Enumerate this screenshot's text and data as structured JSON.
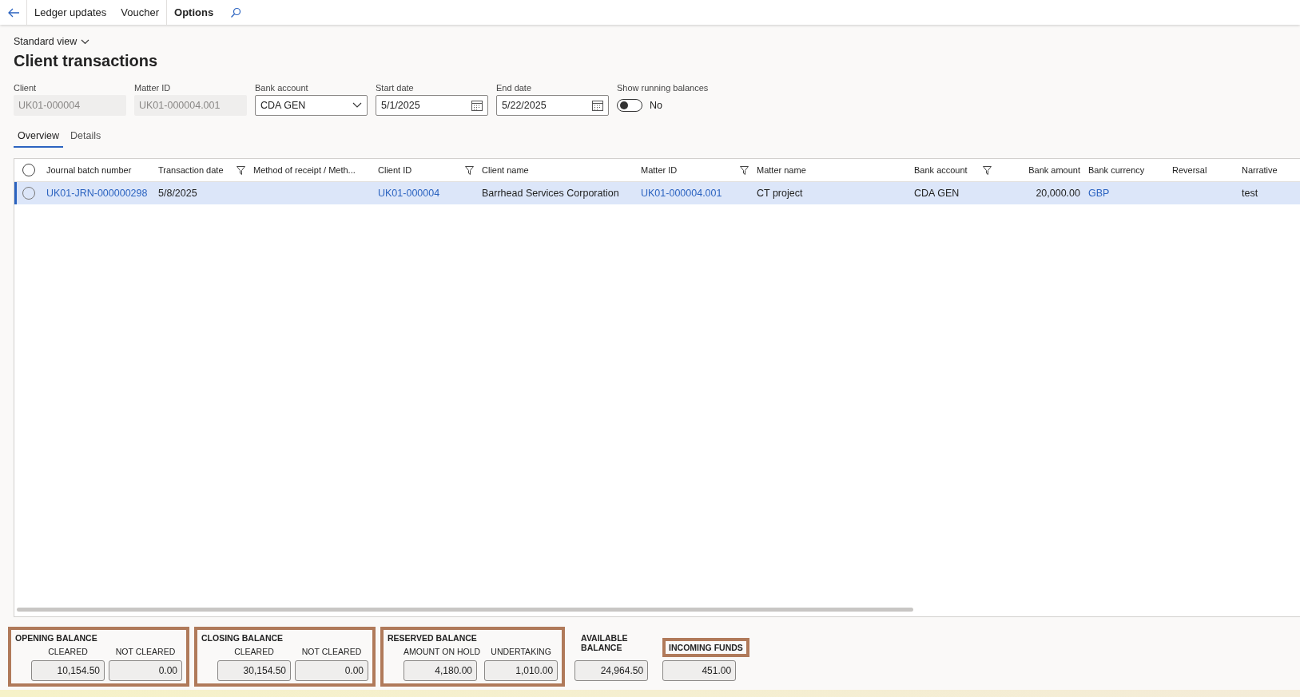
{
  "toolbar": {
    "items": [
      {
        "label": "Ledger updates",
        "selected": false
      },
      {
        "label": "Voucher",
        "selected": false
      },
      {
        "label": "Options",
        "selected": true
      }
    ]
  },
  "view": {
    "label": "Standard view"
  },
  "title": "Client transactions",
  "filters": [
    {
      "label": "Client",
      "value": "UK01-000004",
      "kind": "readonly"
    },
    {
      "label": "Matter ID",
      "value": "UK01-000004.001",
      "kind": "readonly"
    },
    {
      "label": "Bank account",
      "value": "CDA GEN",
      "kind": "dropdown"
    },
    {
      "label": "Start date",
      "value": "5/1/2025",
      "kind": "date"
    },
    {
      "label": "End date",
      "value": "5/22/2025",
      "kind": "date"
    }
  ],
  "running_balances": {
    "label": "Show running balances",
    "on": false,
    "value": "No"
  },
  "tabs": [
    {
      "label": "Overview",
      "selected": true
    },
    {
      "label": "Details",
      "selected": false
    }
  ],
  "table": {
    "columns": [
      {
        "label": "Journal batch number",
        "filtered": false,
        "kind": "text"
      },
      {
        "label": "Transaction date",
        "filtered": true,
        "kind": "text"
      },
      {
        "label": "Method of receipt / Meth...",
        "filtered": false,
        "kind": "text"
      },
      {
        "label": "Client ID",
        "filtered": true,
        "kind": "text"
      },
      {
        "label": "Client name",
        "filtered": false,
        "kind": "text"
      },
      {
        "label": "Matter ID",
        "filtered": true,
        "kind": "text"
      },
      {
        "label": "Matter name",
        "filtered": false,
        "kind": "text"
      },
      {
        "label": "Bank account",
        "filtered": true,
        "kind": "text"
      },
      {
        "label": "Bank amount",
        "filtered": false,
        "kind": "amount"
      },
      {
        "label": "Bank currency",
        "filtered": false,
        "kind": "text"
      },
      {
        "label": "Reversal",
        "filtered": false,
        "kind": "text"
      },
      {
        "label": "Narrative",
        "filtered": false,
        "kind": "text"
      }
    ],
    "all_selected": false,
    "rows": [
      {
        "selected": true,
        "cells": [
          {
            "text": "UK01-JRN-000000298",
            "kind": "link"
          },
          {
            "text": "5/8/2025",
            "kind": "text"
          },
          null,
          {
            "text": "UK01-000004",
            "kind": "link"
          },
          {
            "text": "Barrhead Services Corporation",
            "kind": "text"
          },
          {
            "text": "UK01-000004.001",
            "kind": "link"
          },
          {
            "text": "CT project",
            "kind": "text"
          },
          {
            "text": "CDA GEN",
            "kind": "text"
          },
          {
            "text": "20,000.00",
            "kind": "text"
          },
          {
            "text": "GBP",
            "kind": "link"
          },
          null,
          {
            "text": "test",
            "kind": "text"
          }
        ]
      }
    ]
  },
  "balances": [
    {
      "kind": "group",
      "title": "OPENING BALANCE",
      "highlighted": true,
      "fields": [
        {
          "label": "CLEARED",
          "value": "10,154.50"
        },
        {
          "label": "NOT CLEARED",
          "value": "0.00"
        }
      ]
    },
    {
      "kind": "group",
      "title": "CLOSING BALANCE",
      "highlighted": true,
      "fields": [
        {
          "label": "CLEARED",
          "value": "30,154.50"
        },
        {
          "label": "NOT CLEARED",
          "value": "0.00"
        }
      ]
    },
    {
      "kind": "group",
      "title": "RESERVED BALANCE",
      "highlighted": true,
      "fields": [
        {
          "label": "AMOUNT ON HOLD",
          "value": "4,180.00"
        },
        {
          "label": "UNDERTAKING",
          "value": "1,010.00"
        }
      ]
    },
    {
      "kind": "single",
      "title": "AVAILABLE BALANCE",
      "highlighted": false,
      "value": "24,964.50"
    },
    {
      "kind": "single",
      "title": "INCOMING FUNDS",
      "highlighted": true,
      "value": "451.00"
    }
  ]
}
